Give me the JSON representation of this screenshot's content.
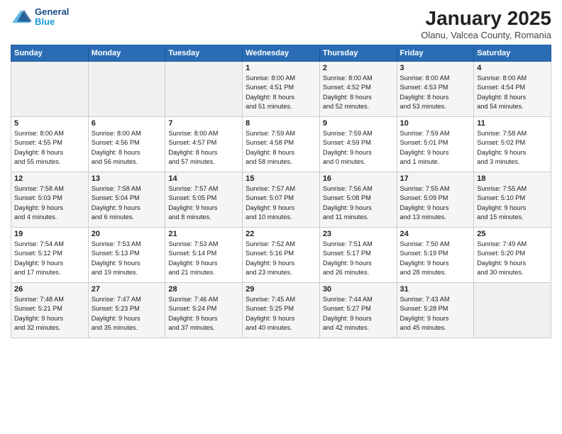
{
  "header": {
    "logo_line1": "General",
    "logo_line2": "Blue",
    "month": "January 2025",
    "location": "Olanu, Valcea County, Romania"
  },
  "weekdays": [
    "Sunday",
    "Monday",
    "Tuesday",
    "Wednesday",
    "Thursday",
    "Friday",
    "Saturday"
  ],
  "weeks": [
    [
      {
        "day": "",
        "info": ""
      },
      {
        "day": "",
        "info": ""
      },
      {
        "day": "",
        "info": ""
      },
      {
        "day": "1",
        "info": "Sunrise: 8:00 AM\nSunset: 4:51 PM\nDaylight: 8 hours\nand 51 minutes."
      },
      {
        "day": "2",
        "info": "Sunrise: 8:00 AM\nSunset: 4:52 PM\nDaylight: 8 hours\nand 52 minutes."
      },
      {
        "day": "3",
        "info": "Sunrise: 8:00 AM\nSunset: 4:53 PM\nDaylight: 8 hours\nand 53 minutes."
      },
      {
        "day": "4",
        "info": "Sunrise: 8:00 AM\nSunset: 4:54 PM\nDaylight: 8 hours\nand 54 minutes."
      }
    ],
    [
      {
        "day": "5",
        "info": "Sunrise: 8:00 AM\nSunset: 4:55 PM\nDaylight: 8 hours\nand 55 minutes."
      },
      {
        "day": "6",
        "info": "Sunrise: 8:00 AM\nSunset: 4:56 PM\nDaylight: 8 hours\nand 56 minutes."
      },
      {
        "day": "7",
        "info": "Sunrise: 8:00 AM\nSunset: 4:57 PM\nDaylight: 8 hours\nand 57 minutes."
      },
      {
        "day": "8",
        "info": "Sunrise: 7:59 AM\nSunset: 4:58 PM\nDaylight: 8 hours\nand 58 minutes."
      },
      {
        "day": "9",
        "info": "Sunrise: 7:59 AM\nSunset: 4:59 PM\nDaylight: 9 hours\nand 0 minutes."
      },
      {
        "day": "10",
        "info": "Sunrise: 7:59 AM\nSunset: 5:01 PM\nDaylight: 9 hours\nand 1 minute."
      },
      {
        "day": "11",
        "info": "Sunrise: 7:58 AM\nSunset: 5:02 PM\nDaylight: 9 hours\nand 3 minutes."
      }
    ],
    [
      {
        "day": "12",
        "info": "Sunrise: 7:58 AM\nSunset: 5:03 PM\nDaylight: 9 hours\nand 4 minutes."
      },
      {
        "day": "13",
        "info": "Sunrise: 7:58 AM\nSunset: 5:04 PM\nDaylight: 9 hours\nand 6 minutes."
      },
      {
        "day": "14",
        "info": "Sunrise: 7:57 AM\nSunset: 5:05 PM\nDaylight: 9 hours\nand 8 minutes."
      },
      {
        "day": "15",
        "info": "Sunrise: 7:57 AM\nSunset: 5:07 PM\nDaylight: 9 hours\nand 10 minutes."
      },
      {
        "day": "16",
        "info": "Sunrise: 7:56 AM\nSunset: 5:08 PM\nDaylight: 9 hours\nand 11 minutes."
      },
      {
        "day": "17",
        "info": "Sunrise: 7:55 AM\nSunset: 5:09 PM\nDaylight: 9 hours\nand 13 minutes."
      },
      {
        "day": "18",
        "info": "Sunrise: 7:55 AM\nSunset: 5:10 PM\nDaylight: 9 hours\nand 15 minutes."
      }
    ],
    [
      {
        "day": "19",
        "info": "Sunrise: 7:54 AM\nSunset: 5:12 PM\nDaylight: 9 hours\nand 17 minutes."
      },
      {
        "day": "20",
        "info": "Sunrise: 7:53 AM\nSunset: 5:13 PM\nDaylight: 9 hours\nand 19 minutes."
      },
      {
        "day": "21",
        "info": "Sunrise: 7:53 AM\nSunset: 5:14 PM\nDaylight: 9 hours\nand 21 minutes."
      },
      {
        "day": "22",
        "info": "Sunrise: 7:52 AM\nSunset: 5:16 PM\nDaylight: 9 hours\nand 23 minutes."
      },
      {
        "day": "23",
        "info": "Sunrise: 7:51 AM\nSunset: 5:17 PM\nDaylight: 9 hours\nand 26 minutes."
      },
      {
        "day": "24",
        "info": "Sunrise: 7:50 AM\nSunset: 5:19 PM\nDaylight: 9 hours\nand 28 minutes."
      },
      {
        "day": "25",
        "info": "Sunrise: 7:49 AM\nSunset: 5:20 PM\nDaylight: 9 hours\nand 30 minutes."
      }
    ],
    [
      {
        "day": "26",
        "info": "Sunrise: 7:48 AM\nSunset: 5:21 PM\nDaylight: 9 hours\nand 32 minutes."
      },
      {
        "day": "27",
        "info": "Sunrise: 7:47 AM\nSunset: 5:23 PM\nDaylight: 9 hours\nand 35 minutes."
      },
      {
        "day": "28",
        "info": "Sunrise: 7:46 AM\nSunset: 5:24 PM\nDaylight: 9 hours\nand 37 minutes."
      },
      {
        "day": "29",
        "info": "Sunrise: 7:45 AM\nSunset: 5:25 PM\nDaylight: 9 hours\nand 40 minutes."
      },
      {
        "day": "30",
        "info": "Sunrise: 7:44 AM\nSunset: 5:27 PM\nDaylight: 9 hours\nand 42 minutes."
      },
      {
        "day": "31",
        "info": "Sunrise: 7:43 AM\nSunset: 5:28 PM\nDaylight: 9 hours\nand 45 minutes."
      },
      {
        "day": "",
        "info": ""
      }
    ]
  ]
}
